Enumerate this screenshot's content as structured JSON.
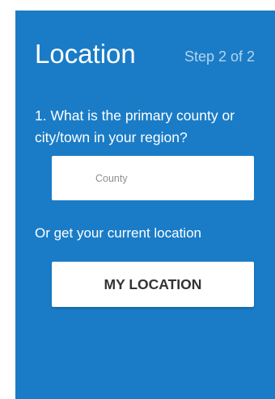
{
  "header": {
    "title": "Location",
    "step": "Step 2 of 2"
  },
  "question": {
    "text": "1. What is the primary county or city/town in your region?"
  },
  "county_field": {
    "placeholder": "County",
    "value": ""
  },
  "alternative": {
    "text": "Or get your current location"
  },
  "location_button": {
    "label": "MY LOCATION"
  },
  "colors": {
    "panel_background": "#1a7cc7",
    "step_text": "#b4d4ef",
    "text": "#ffffff",
    "button_text": "#333333"
  }
}
